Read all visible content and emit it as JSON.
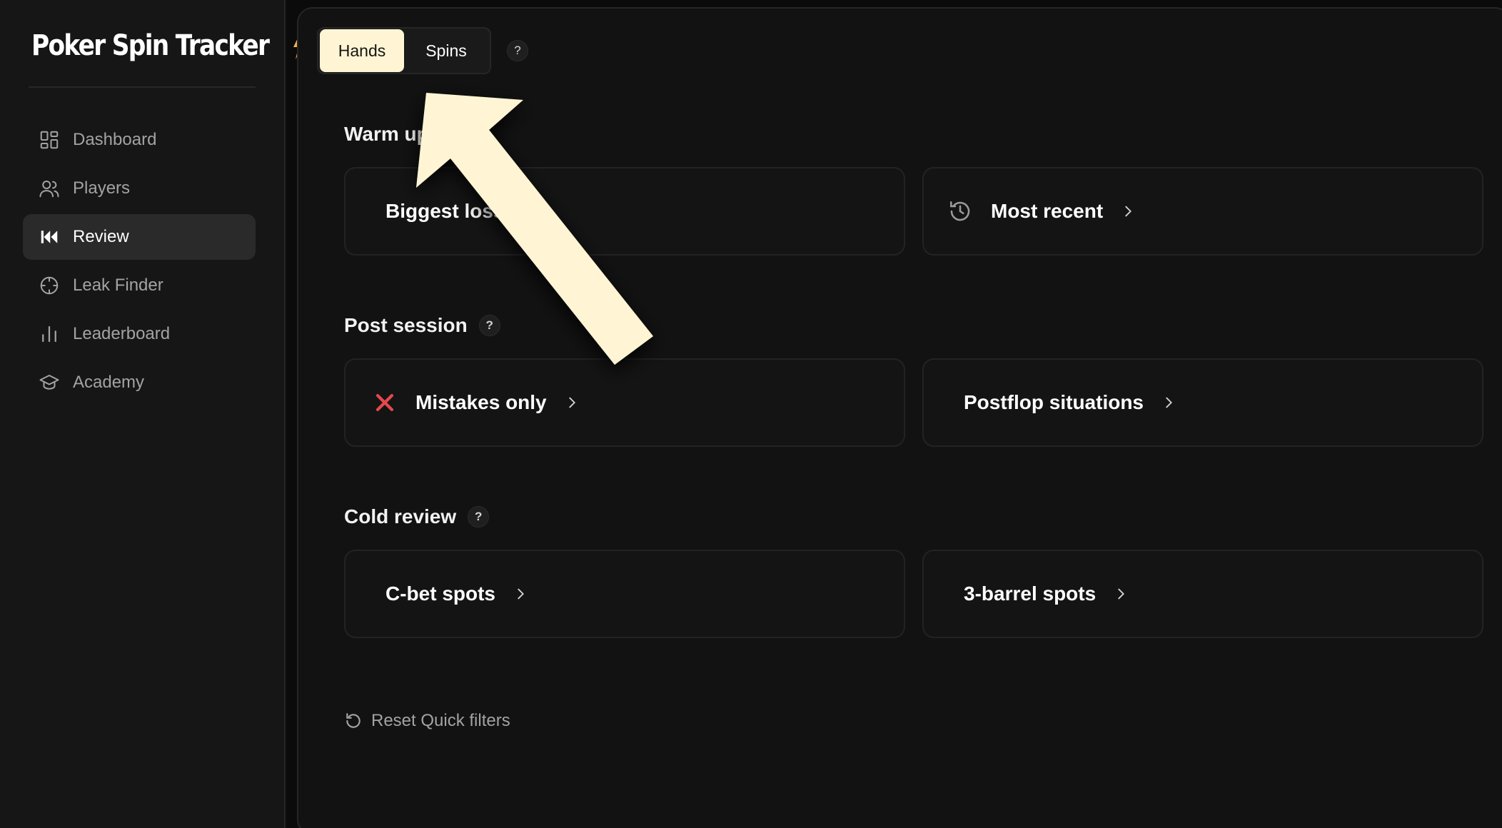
{
  "app": {
    "title": "Poker Spin Tracker",
    "logo_icon": "lightning-bolt-icon",
    "accent_color": "#f0b24a"
  },
  "sidebar": {
    "items": [
      {
        "label": "Dashboard",
        "icon": "grid-icon",
        "active": false
      },
      {
        "label": "Players",
        "icon": "users-icon",
        "active": false
      },
      {
        "label": "Review",
        "icon": "rewind-icon",
        "active": true
      },
      {
        "label": "Leak Finder",
        "icon": "crosshair-icon",
        "active": false
      },
      {
        "label": "Leaderboard",
        "icon": "bar-chart-icon",
        "active": false
      },
      {
        "label": "Academy",
        "icon": "graduation-cap-icon",
        "active": false
      }
    ]
  },
  "toggle": {
    "options": [
      "Hands",
      "Spins"
    ],
    "selected": "Hands",
    "selected_bg": "#fff5d4",
    "help": "?"
  },
  "sections": [
    {
      "title": "Warm up",
      "help": "?",
      "cards": [
        {
          "label": "Biggest losses",
          "icon": ""
        },
        {
          "label": "Most recent",
          "icon": "history-icon"
        }
      ]
    },
    {
      "title": "Post session",
      "help": "?",
      "cards": [
        {
          "label": "Mistakes only",
          "icon": "x-mark-icon",
          "icon_color": "#e5484d"
        },
        {
          "label": "Postflop situations",
          "icon": ""
        }
      ]
    },
    {
      "title": "Cold review",
      "help": "?",
      "cards": [
        {
          "label": "C-bet spots",
          "icon": ""
        },
        {
          "label": "3-barrel spots",
          "icon": ""
        }
      ]
    }
  ],
  "reset": {
    "label": "Reset Quick filters",
    "icon": "reset-icon"
  },
  "overlay": {
    "icon": "pointer-arrow-icon",
    "color": "#fff5d4"
  }
}
